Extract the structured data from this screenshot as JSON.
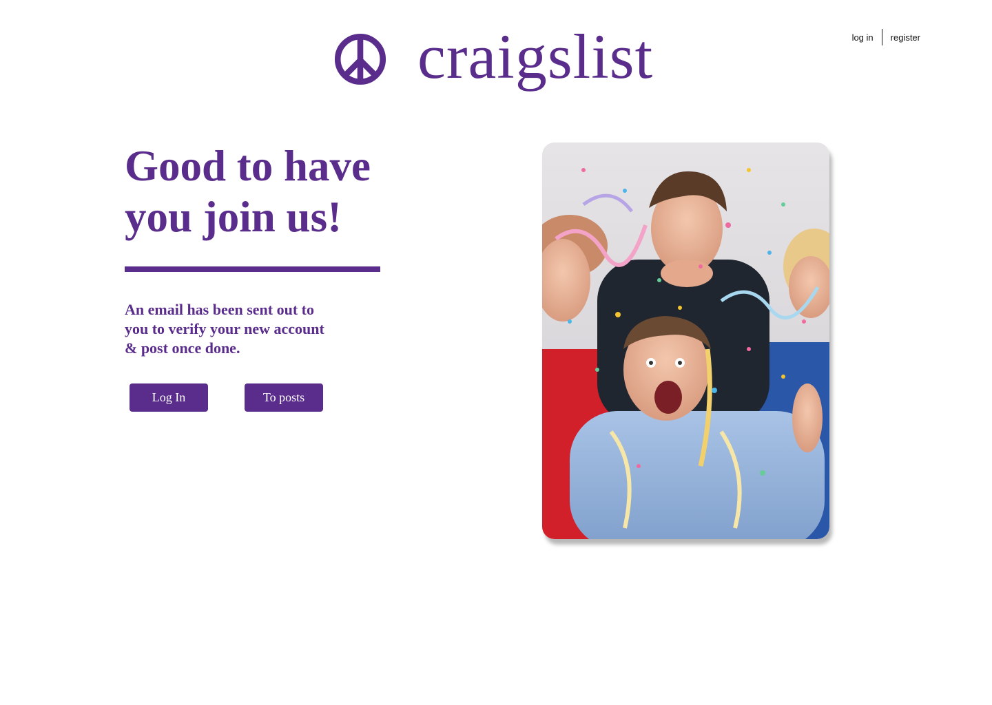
{
  "header": {
    "brand": "craigslist",
    "logo_icon": "peace-sign-icon",
    "nav": {
      "login": "log in",
      "register": "register"
    }
  },
  "main": {
    "headline": "Good to have you join us!",
    "message": "An email has been sent out to you to verify your new account & post once done.",
    "buttons": {
      "login": "Log In",
      "posts": "To posts"
    },
    "image_description_icon": "celebration-photo"
  },
  "colors": {
    "brand_purple": "#5a2d8c",
    "background": "#ffffff",
    "button_text": "#ffffff"
  }
}
